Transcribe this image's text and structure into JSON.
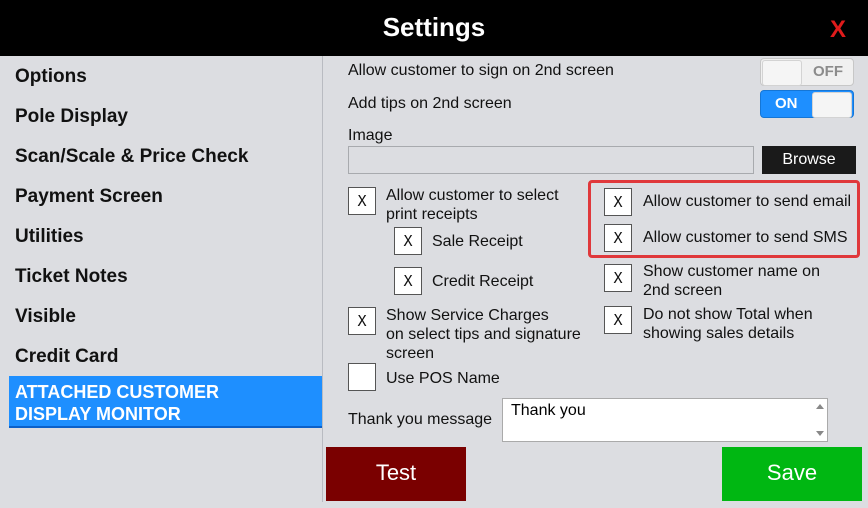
{
  "window": {
    "title": "Settings",
    "close_label": "X"
  },
  "sidebar": {
    "items": [
      {
        "label": "Options"
      },
      {
        "label": "Pole Display"
      },
      {
        "label": "Scan/Scale & Price Check"
      },
      {
        "label": "Payment Screen"
      },
      {
        "label": "Utilities"
      },
      {
        "label": "Ticket Notes"
      },
      {
        "label": "Visible"
      },
      {
        "label": "Credit Card"
      }
    ],
    "active_line1": "ATTACHED CUSTOMER",
    "active_line2": "DISPLAY MONITOR"
  },
  "main": {
    "sign_2nd_label": "Allow customer to sign on 2nd screen",
    "sign_2nd_toggle": "OFF",
    "tips_2nd_label": "Add tips on 2nd screen",
    "tips_2nd_toggle": "ON",
    "image_label": "Image",
    "image_value": "",
    "browse_label": "Browse",
    "checkbox_mark": "X",
    "select_receipts_line1": "Allow customer to select",
    "select_receipts_line2": "print receipts",
    "sale_receipt": "Sale Receipt",
    "credit_receipt": "Credit Receipt",
    "send_email": "Allow customer to send email",
    "send_sms": "Allow customer to send SMS",
    "show_name_line1": "Show customer name on",
    "show_name_line2": "2nd screen",
    "service_line1": "Show Service Charges",
    "service_line2": "on select tips and signature",
    "service_line3": "screen",
    "no_total_line1": "Do not show Total when",
    "no_total_line2": "showing sales details",
    "use_pos_name": "Use POS Name",
    "thank_you_label": "Thank you message",
    "thank_you_value": "Thank you",
    "test_label": "Test",
    "save_label": "Save"
  },
  "colors": {
    "accent": "#1e8fff",
    "test_button": "#7a0000",
    "save_button": "#00b712",
    "highlight": "#e0383b",
    "close": "#e01b1b"
  }
}
